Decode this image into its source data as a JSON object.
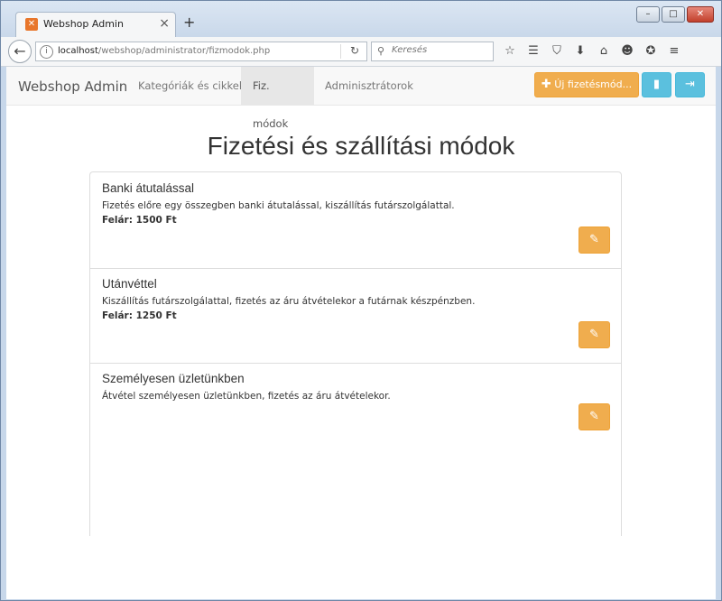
{
  "browser": {
    "tab_title": "Webshop Admin",
    "tab_favicon": "xampp-icon",
    "url_prefix": "localhost",
    "url_path": "/webshop/administrator/fizmodok.php",
    "search_placeholder": "Keresés"
  },
  "app": {
    "brand": "Webshop Admin",
    "nav": [
      {
        "label": "Kategóriák és cikkek",
        "active": false
      },
      {
        "label": "Fiz. módok",
        "active": true
      },
      {
        "label": "Adminisztrátorok",
        "active": false
      }
    ],
    "new_button_label": "Új fizetésmód...",
    "colors": {
      "warning": "#f0ad4e",
      "info": "#5bc0de"
    }
  },
  "page": {
    "title": "Fizetési és szállítási módok",
    "methods": [
      {
        "name": "Banki átutalással",
        "description": "Fizetés előre egy összegben banki átutalással, kiszállítás futárszolgálattal.",
        "fee": "Felár: 1500 Ft"
      },
      {
        "name": "Utánvéttel",
        "description": "Kiszállítás futárszolgálattal, fizetés az áru átvételekor a futárnak készpénzben.",
        "fee": "Felár: 1250 Ft"
      },
      {
        "name": "Személyesen üzletünkben",
        "description": "Átvétel személyesen üzletünkben, fizetés az áru átvételekor.",
        "fee": ""
      }
    ]
  }
}
